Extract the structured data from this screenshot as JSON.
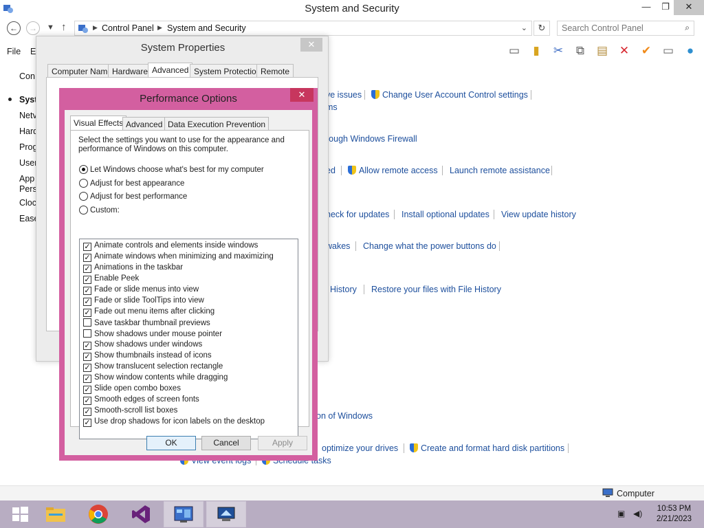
{
  "window": {
    "title": "System and Security",
    "controls": {
      "minimize": "—",
      "maximize": "❐",
      "close": "✕"
    }
  },
  "address": {
    "crumbs": [
      "Control Panel",
      "System and Security"
    ],
    "search_placeholder": "Search Control Panel"
  },
  "menu": {
    "file": "File",
    "edit": "E"
  },
  "sidebar": {
    "items": [
      "Con",
      "Syst",
      "Netv",
      "Hard",
      "Prog",
      "User",
      "App",
      "Pers",
      "Cloc",
      "Ease"
    ]
  },
  "links": {
    "ve_issues": "ve issues",
    "uac": "Change User Account Control settings",
    "ms": "ms",
    "firewall": "rough Windows Firewall",
    "ed": "ed",
    "allow_remote": "Allow remote access",
    "launch_remote": "Launch remote assistance",
    "check_updates": "heck for updates",
    "install_optional": "Install optional updates",
    "view_history": "View update history",
    "wakes": "wakes",
    "power_buttons": "Change what the power buttons do",
    "history": "History",
    "restore_files": "Restore your files with File History",
    "of_windows": "on of Windows",
    "optimize": "optimize your drives",
    "partitions": "Create and format hard disk partitions",
    "event_logs": "View event logs",
    "schedule": "Schedule tasks"
  },
  "system_properties": {
    "title": "System Properties",
    "tabs": [
      "Computer Name",
      "Hardware",
      "Advanced",
      "System Protection",
      "Remote"
    ],
    "active_tab": "Advanced"
  },
  "performance_options": {
    "title": "Performance Options",
    "tabs": [
      "Visual Effects",
      "Advanced",
      "Data Execution Prevention"
    ],
    "active_tab": "Visual Effects",
    "description": "Select the settings you want to use for the appearance and performance of Windows on this computer.",
    "radios": [
      {
        "label": "Let Windows choose what's best for my computer",
        "selected": true
      },
      {
        "label": "Adjust for best appearance",
        "selected": false
      },
      {
        "label": "Adjust for best performance",
        "selected": false
      },
      {
        "label": "Custom:",
        "selected": false
      }
    ],
    "effects": [
      {
        "label": "Animate controls and elements inside windows",
        "checked": true
      },
      {
        "label": "Animate windows when minimizing and maximizing",
        "checked": true
      },
      {
        "label": "Animations in the taskbar",
        "checked": true
      },
      {
        "label": "Enable Peek",
        "checked": true
      },
      {
        "label": "Fade or slide menus into view",
        "checked": true
      },
      {
        "label": "Fade or slide ToolTips into view",
        "checked": true
      },
      {
        "label": "Fade out menu items after clicking",
        "checked": true
      },
      {
        "label": "Save taskbar thumbnail previews",
        "checked": false
      },
      {
        "label": "Show shadows under mouse pointer",
        "checked": false
      },
      {
        "label": "Show shadows under windows",
        "checked": true
      },
      {
        "label": "Show thumbnails instead of icons",
        "checked": true
      },
      {
        "label": "Show translucent selection rectangle",
        "checked": true
      },
      {
        "label": "Show window contents while dragging",
        "checked": true
      },
      {
        "label": "Slide open combo boxes",
        "checked": true
      },
      {
        "label": "Smooth edges of screen fonts",
        "checked": true
      },
      {
        "label": "Smooth-scroll list boxes",
        "checked": true
      },
      {
        "label": "Use drop shadows for icon labels on the desktop",
        "checked": true
      }
    ],
    "buttons": {
      "ok": "OK",
      "cancel": "Cancel",
      "apply": "Apply"
    }
  },
  "statusbar": {
    "computer": "Computer"
  },
  "taskbar": {
    "time": "10:53 PM",
    "date": "2/21/2023",
    "apps": [
      "start",
      "file-explorer",
      "chrome",
      "visual-studio",
      "control-panel",
      "system-properties"
    ]
  },
  "colors": {
    "dialog_frame": "#d35fa0",
    "link": "#1c4e9c",
    "taskbar": "#b8adc2"
  }
}
